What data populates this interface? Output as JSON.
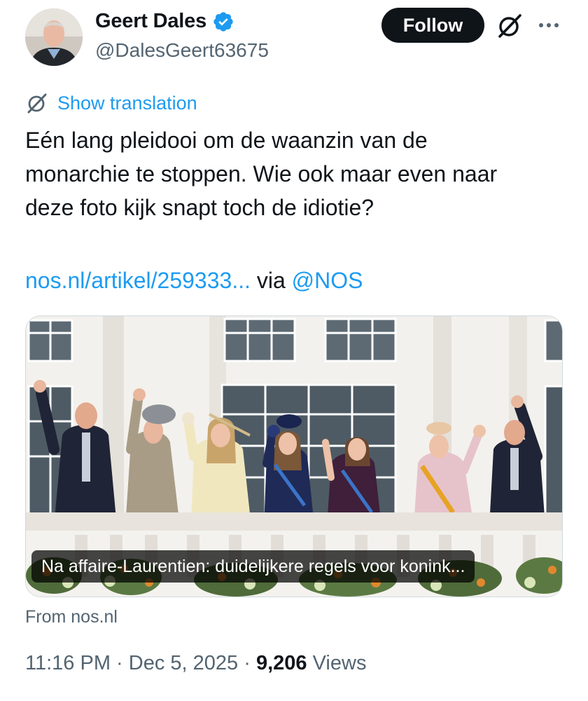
{
  "author": {
    "display_name": "Geert Dales",
    "handle": "@DalesGeert63675",
    "verified": true
  },
  "actions": {
    "follow_label": "Follow",
    "grok_icon": "grok-icon",
    "more_icon": "more-icon"
  },
  "translation": {
    "label": "Show translation",
    "icon": "grok-icon"
  },
  "tweet": {
    "text_lines": [
      "Eén lang pleidooi om de waanzin van de",
      "monarchie te stoppen. Wie ook maar even naar",
      "deze foto kijk snapt toch de idiotie?"
    ],
    "link_text": "nos.nl/artikel/259333...",
    "via_text": "via",
    "mention": "@NOS"
  },
  "card": {
    "headline": "Na affaire-Laurentien: duidelijkere regels voor konink...",
    "source": "From nos.nl"
  },
  "meta": {
    "time": "11:16 PM",
    "separator": "·",
    "date": "Dec 5, 2025",
    "views_count": "9,206",
    "views_label": "Views"
  },
  "colors": {
    "accent": "#1d9bf0",
    "text": "#0f1419",
    "secondary": "#536471",
    "verified_badge": "#1d9bf0"
  }
}
